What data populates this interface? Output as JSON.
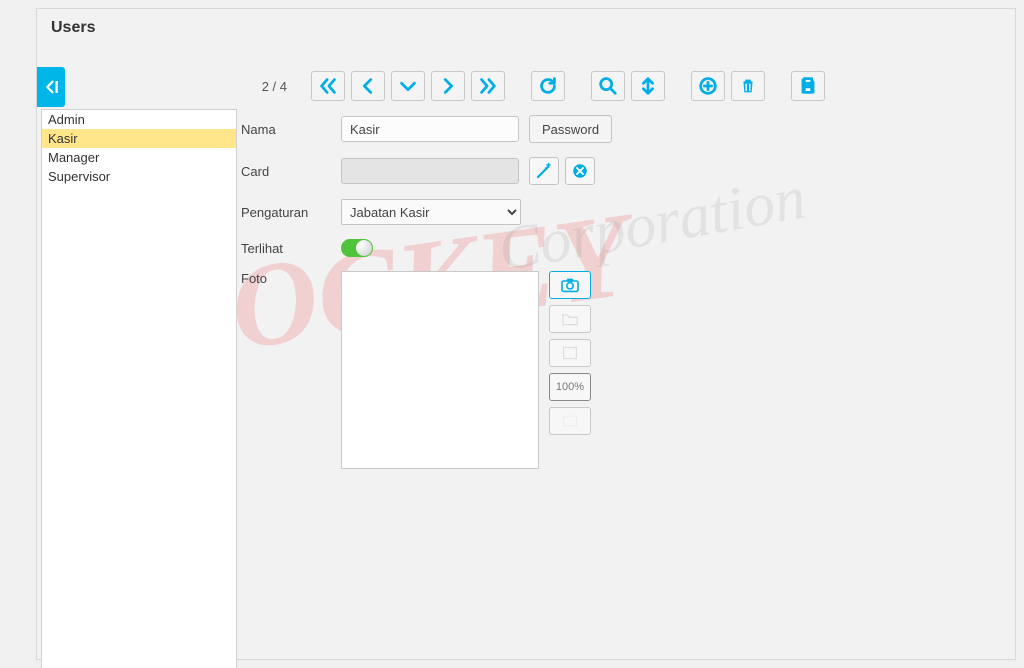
{
  "title": "Users",
  "counter": "2 / 4",
  "userList": [
    "Admin",
    "Kasir",
    "Manager",
    "Supervisor"
  ],
  "selectedUserIndex": 1,
  "form": {
    "labels": {
      "nama": "Nama",
      "card": "Card",
      "pengaturan": "Pengaturan",
      "terlihat": "Terlihat",
      "foto": "Foto"
    },
    "nama_value": "Kasir",
    "card_value": "",
    "pengaturan_value": "Jabatan Kasir",
    "password_button": "Password",
    "zoom_label": "100%"
  },
  "pengaturan_options": [
    "Jabatan Kasir"
  ],
  "watermark1": "HOCKEY",
  "watermark2": "Corporation"
}
